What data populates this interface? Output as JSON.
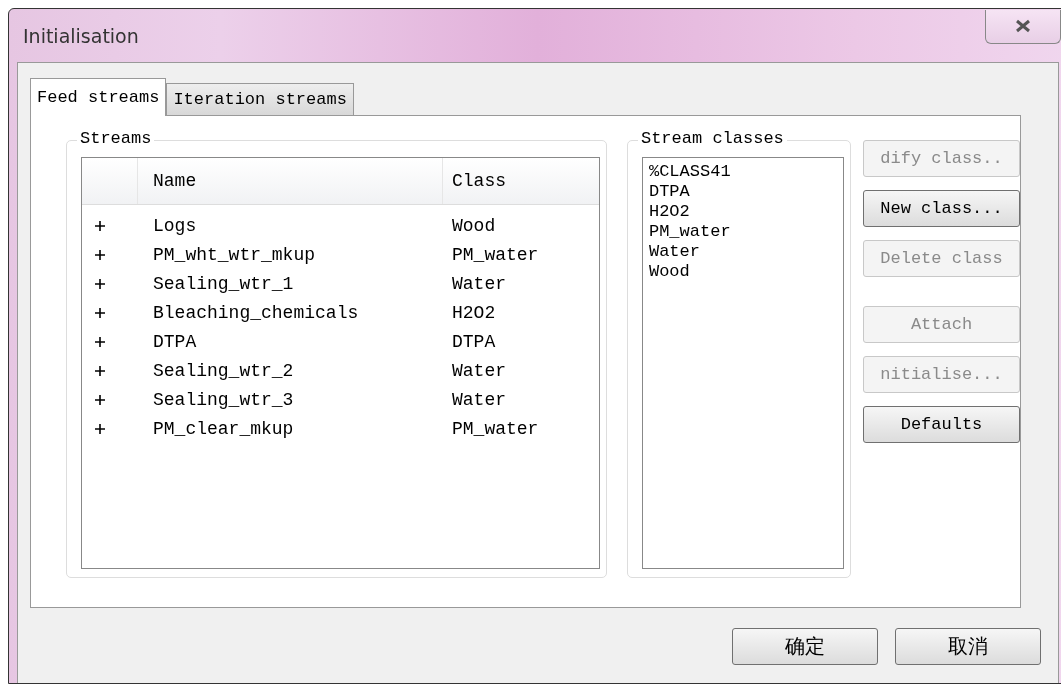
{
  "window": {
    "title": "Initialisation"
  },
  "tabs": [
    {
      "label": "Feed streams",
      "selected": true
    },
    {
      "label": "Iteration streams",
      "selected": false
    }
  ],
  "streams": {
    "title": "Streams",
    "columns": [
      "Name",
      "Class"
    ],
    "rows": [
      {
        "expanded": false,
        "name": "Logs",
        "class": "Wood"
      },
      {
        "expanded": false,
        "name": "PM_wht_wtr_mkup",
        "class": "PM_water"
      },
      {
        "expanded": false,
        "name": "Sealing_wtr_1",
        "class": "Water"
      },
      {
        "expanded": false,
        "name": "Bleaching_chemicals",
        "class": "H2O2"
      },
      {
        "expanded": false,
        "name": "DTPA",
        "class": "DTPA"
      },
      {
        "expanded": false,
        "name": "Sealing_wtr_2",
        "class": "Water"
      },
      {
        "expanded": false,
        "name": "Sealing_wtr_3",
        "class": "Water"
      },
      {
        "expanded": false,
        "name": "PM_clear_mkup",
        "class": "PM_water"
      }
    ]
  },
  "stream_classes": {
    "title": "Stream classes",
    "items": [
      "%CLASS41",
      "DTPA",
      "H2O2",
      "PM_water",
      "Water",
      "Wood"
    ]
  },
  "side_buttons": [
    {
      "label": "dify class..",
      "disabled": true
    },
    {
      "label": "New class...",
      "disabled": false
    },
    {
      "label": "Delete class",
      "disabled": true
    },
    {
      "label": "Attach",
      "disabled": true
    },
    {
      "label": "nitialise...",
      "disabled": true
    },
    {
      "label": "Defaults",
      "disabled": false
    }
  ],
  "dialog_buttons": [
    "确定",
    "取消"
  ]
}
